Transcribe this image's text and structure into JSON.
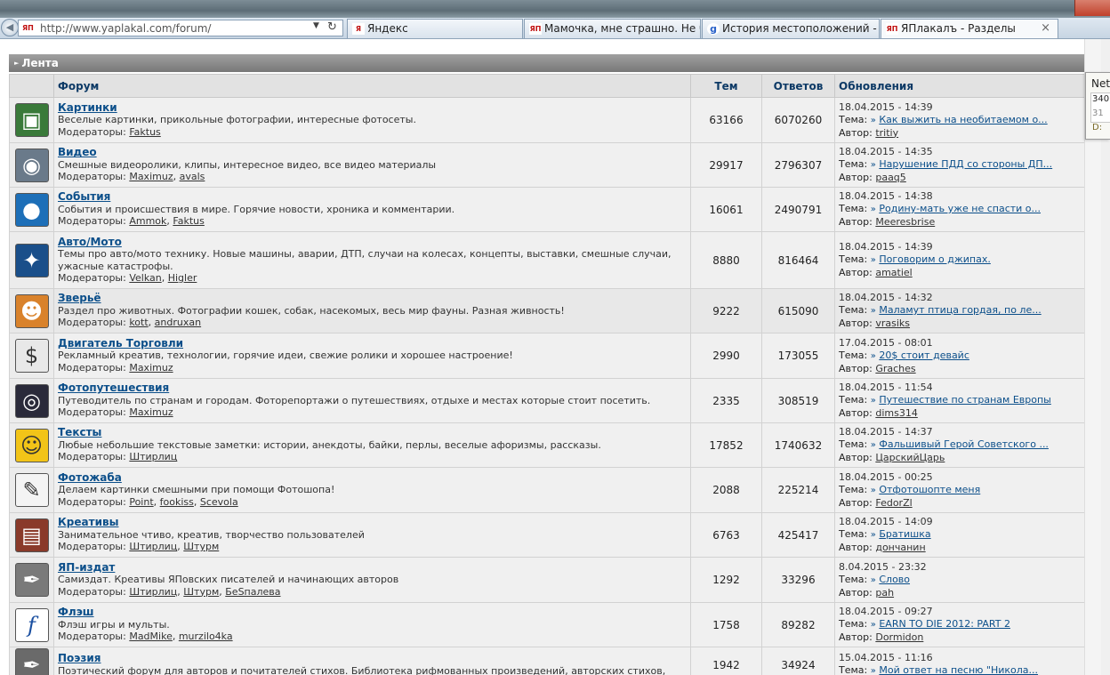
{
  "browser": {
    "address_url": "http://www.yaplakal.com/forum/",
    "address_favicon": "ЯП",
    "tabs": [
      {
        "label": "Яндекс",
        "favicon": "Я",
        "active": false
      },
      {
        "label": "Мамочка, мне страшно. Не б...",
        "favicon": "ЯП",
        "active": false
      },
      {
        "label": "История местоположений - ...",
        "favicon": "g",
        "active": false
      },
      {
        "label": "ЯПлакалъ - Разделы",
        "favicon": "ЯП",
        "active": true
      }
    ],
    "tab_close": "×"
  },
  "section": {
    "title": "Лента"
  },
  "table": {
    "headers": {
      "forum": "Форум",
      "topics": "Тем",
      "replies": "Ответов",
      "updates": "Обновления"
    },
    "mods_label": "Модераторы:",
    "topic_label": "Тема:",
    "author_label": "Автор:",
    "rows": [
      {
        "title": "Картинки",
        "desc": "Веселые картинки, прикольные фотографии, интересные фотосеты.",
        "mods": [
          "Faktus"
        ],
        "topics": "63166",
        "replies": "6070260",
        "date": "18.04.2015 - 14:39",
        "topic": "Как выжить на необитаемом о...",
        "author": "tritiy",
        "icon": "pictures-icon",
        "color": "#3a7a3a",
        "glyph": "▣"
      },
      {
        "title": "Видео",
        "desc": "Смешные видеоролики, клипы, интересное видео, все видео материалы",
        "mods": [
          "Maximuz",
          "avals"
        ],
        "topics": "29917",
        "replies": "2796307",
        "date": "18.04.2015 - 14:35",
        "topic": "Нарушение ПДД со стороны ДП...",
        "author": "paaq5",
        "icon": "film-reel-icon",
        "color": "#6a7a8a",
        "glyph": "◉"
      },
      {
        "title": "События",
        "desc": "События и происшествия в мире. Горячие новости, хроника и комментарии.",
        "mods": [
          "Ammok",
          "Faktus"
        ],
        "topics": "16061",
        "replies": "2490791",
        "date": "18.04.2015 - 14:38",
        "topic": "Родину-мать уже не спасти о...",
        "author": "Meeresbrise",
        "icon": "globe-icon",
        "color": "#1d6fb8",
        "glyph": "●"
      },
      {
        "title": "Авто/Мото",
        "desc": "Темы про авто/мото технику. Новые машины, аварии, ДТП, случаи на колесах, концепты, выставки, смешные случаи, ужасные катастрофы.",
        "mods": [
          "Velkan",
          "Higler"
        ],
        "topics": "8880",
        "replies": "816464",
        "date": "18.04.2015 - 14:39",
        "topic": "Поговорим о джипах.",
        "author": "amatiel",
        "icon": "wheel-icon",
        "color": "#1a4f8a",
        "glyph": "✦"
      },
      {
        "title": "Зверьё",
        "desc": "Раздел про животных. Фотографии кошек, собак, насекомых, весь мир фауны. Разная живность!",
        "mods": [
          "kott",
          "andruxan"
        ],
        "topics": "9222",
        "replies": "615090",
        "date": "18.04.2015 - 14:32",
        "topic": "Маламут птица гордая, по ле...",
        "author": "vrasiks",
        "icon": "cat-icon",
        "color": "#d9822b",
        "glyph": "☻"
      },
      {
        "title": "Двигатель Торговли",
        "desc": "Рекламный креатив, технологии, горячие идеи, свежие ролики и хорошее настроение!",
        "mods": [
          "Maximuz"
        ],
        "topics": "2990",
        "replies": "173055",
        "date": "17.04.2015 - 08:01",
        "topic": "20$ стоит девайс",
        "author": "Graches",
        "icon": "dollar-icon",
        "color": "#e8e8e8",
        "glyph": "$"
      },
      {
        "title": "Фотопутешествия",
        "desc": "Путеводитель по странам и городам. Фоторепортажи о путешествиях, отдыхе и местах которые стоит посетить.",
        "mods": [
          "Maximuz"
        ],
        "topics": "2335",
        "replies": "308519",
        "date": "18.04.2015 - 11:54",
        "topic": "Путешествие по странам Европы",
        "author": "dims314",
        "icon": "camera-lens-icon",
        "color": "#2a2a3a",
        "glyph": "◎"
      },
      {
        "title": "Тексты",
        "desc": "Любые небольшие текстовые заметки: истории, анекдоты, байки, перлы, веселые афоризмы, рассказы.",
        "mods": [
          "Штирлиц"
        ],
        "topics": "17852",
        "replies": "1740632",
        "date": "18.04.2015 - 14:37",
        "topic": "Фальшивый Герой Советского ...",
        "author": "ЦарскийЦарь",
        "icon": "smiley-icon",
        "color": "#f2c418",
        "glyph": "☺"
      },
      {
        "title": "Фотожаба",
        "desc": "Делаем картинки смешными при помощи Фотошопа!",
        "mods": [
          "Point",
          "fookiss",
          "Scevola"
        ],
        "topics": "2088",
        "replies": "225214",
        "date": "18.04.2015 - 00:25",
        "topic": "Отфотошопте меня",
        "author": "FedorZl",
        "icon": "frog-icon",
        "color": "#f4f4f4",
        "glyph": "✎"
      },
      {
        "title": "Креативы",
        "desc": "Занимательное чтиво, креатив, творчество пользователей",
        "mods": [
          "Штирлиц",
          "Штурм"
        ],
        "topics": "6763",
        "replies": "425417",
        "date": "18.04.2015 - 14:09",
        "topic": "Братишка",
        "author": "дончанин",
        "icon": "books-icon",
        "color": "#8a3a2a",
        "glyph": "▤"
      },
      {
        "title": "ЯП-издат",
        "desc": "Самиздат. Креативы ЯПовских писателей и начинающих авторов",
        "mods": [
          "Штирлиц",
          "Штурм",
          "БеSпалева"
        ],
        "topics": "1292",
        "replies": "33296",
        "date": "8.04.2015 - 23:32",
        "topic": "Слово",
        "author": "pah",
        "icon": "quill-icon",
        "color": "#7a7a7a",
        "glyph": "✒"
      },
      {
        "title": "Флэш",
        "desc": "Флэш игры и мульты.",
        "mods": [
          "MadMike",
          "murzilo4ka"
        ],
        "topics": "1758",
        "replies": "89282",
        "date": "18.04.2015 - 09:27",
        "topic": "EARN TO DIE 2012: PART 2",
        "author": "Dormidon",
        "icon": "flash-icon",
        "color": "#ffffff",
        "glyph": "f"
      },
      {
        "title": "Поэзия",
        "desc": "Поэтический форум для авторов и почитателей стихов. Библиотека рифмованных произведений, авторских стихов,",
        "mods": [],
        "topics": "1942",
        "replies": "34924",
        "date": "15.04.2015 - 11:16",
        "topic": "Мой ответ на песню \"Никола...",
        "author": "",
        "icon": "quill-icon",
        "color": "#6a6a6a",
        "glyph": "✒"
      }
    ]
  },
  "tooltip": {
    "title": "Net",
    "value1": "340",
    "value2": "31",
    "label": "D:"
  }
}
